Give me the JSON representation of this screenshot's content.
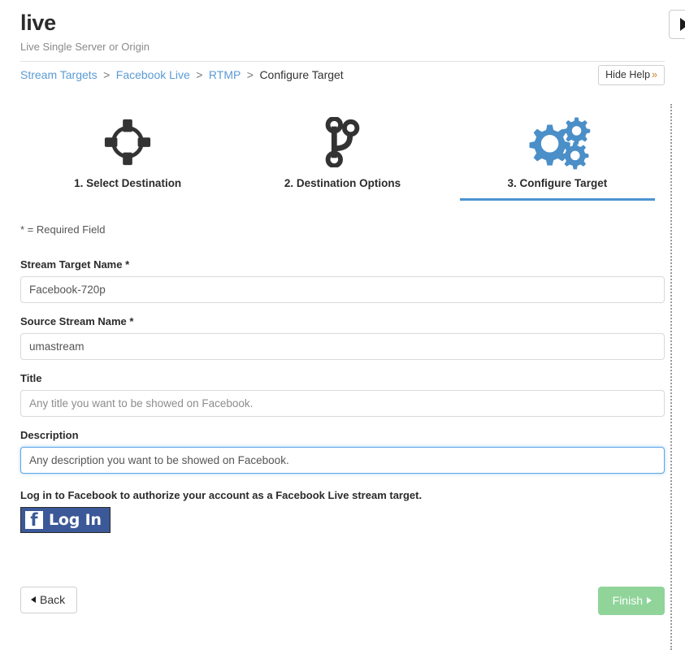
{
  "header": {
    "title": "live",
    "subtitle": "Live Single Server or Origin",
    "expand_icon": "play-triangle-icon"
  },
  "breadcrumb": {
    "items": [
      "Stream Targets",
      "Facebook Live",
      "RTMP",
      "Configure Target"
    ],
    "separator": ">",
    "hide_help_label": "Hide Help",
    "hide_help_chevron": "»"
  },
  "wizard": {
    "steps": [
      {
        "label": "1. Select Destination",
        "icon": "crosshair-target-icon",
        "active": false
      },
      {
        "label": "2. Destination Options",
        "icon": "code-branch-icon",
        "active": false
      },
      {
        "label": "3. Configure Target",
        "icon": "gears-icon",
        "active": true
      }
    ],
    "active_underline_color": "#4b93d1",
    "active_icon_color": "#4b8fc8",
    "inactive_icon_color": "#333333"
  },
  "form": {
    "required_note": "* = Required Field",
    "fields": [
      {
        "label": "Stream Target Name",
        "required_mark": "*",
        "value": "Facebook-720p",
        "placeholder": "",
        "focused": false
      },
      {
        "label": "Source Stream Name",
        "required_mark": "*",
        "value": "umastream",
        "placeholder": "",
        "focused": false
      },
      {
        "label": "Title",
        "required_mark": "",
        "value": "",
        "placeholder": "Any title you want to be showed on Facebook.",
        "focused": false
      },
      {
        "label": "Description",
        "required_mark": "",
        "value": "Any description you want to be showed on Facebook.",
        "placeholder": "",
        "focused": true
      }
    ]
  },
  "facebook": {
    "prompt": "Log in to Facebook to authorize your account as a Facebook Live stream target.",
    "button_label": "Log In",
    "mark_letter": "f",
    "brand_color": "#3b5998"
  },
  "footer": {
    "back_label": "Back",
    "finish_label": "Finish",
    "finish_color": "#90d49a"
  }
}
